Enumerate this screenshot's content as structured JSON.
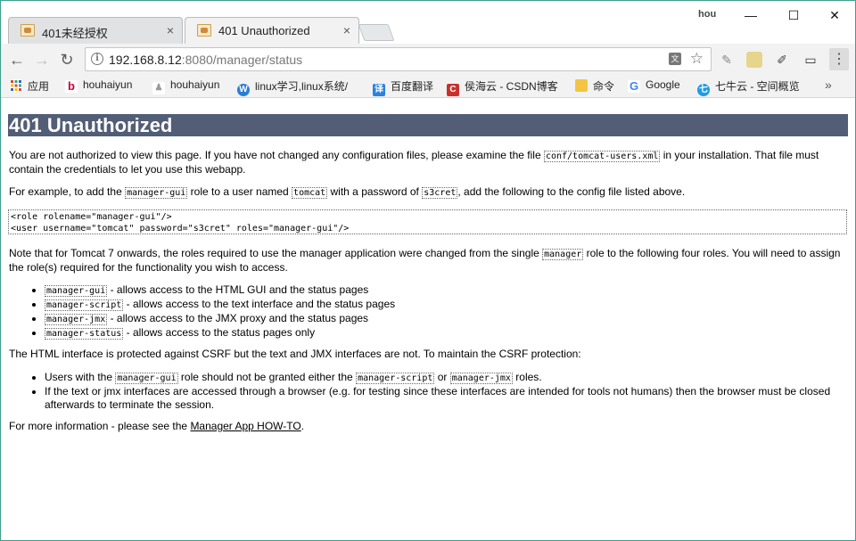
{
  "window": {
    "tabs": [
      {
        "label": "401未经授权",
        "close": "×",
        "active": false
      },
      {
        "label": "401 Unauthorized",
        "close": "×",
        "active": true
      }
    ],
    "user_badge": "hou",
    "minimize": "—",
    "maximize": "☐",
    "close": "✕"
  },
  "toolbar": {
    "back": "←",
    "forward": "→",
    "reload": "↻",
    "info_icon": "i",
    "url_host": "192.168.8.12",
    "url_rest": ":8080/manager/status",
    "star": "☆",
    "menu": "⋮"
  },
  "bookmarks": {
    "items": [
      {
        "label": "应用",
        "icon": "apps-icon"
      },
      {
        "label": "houhaiyun",
        "icon": "bookmark-icon"
      },
      {
        "label": "houhaiyun",
        "icon": "bookmark-icon"
      },
      {
        "label": "linux学习,linux系统/",
        "icon": "bookmark-icon"
      },
      {
        "label": "百度翻译",
        "icon": "translate-icon"
      },
      {
        "label": "侯海云 - CSDN博客",
        "icon": "csdn-icon"
      },
      {
        "label": "命令",
        "icon": "folder-icon"
      },
      {
        "label": "Google",
        "icon": "google-icon"
      },
      {
        "label": "七牛云 - 空间概览",
        "icon": "qiniu-icon"
      }
    ],
    "more": "»"
  },
  "page": {
    "title": "401 Unauthorized",
    "p1_a": "You are not authorized to view this page. If you have not changed any configuration files, please examine the file ",
    "p1_code": "conf/tomcat-users.xml",
    "p1_b": " in your installation. That file must",
    "p1_c": "contain the credentials to let you use this webapp.",
    "p2_a": "For example, to add the ",
    "p2_code1": "manager-gui",
    "p2_b": " role to a user named ",
    "p2_code2": "tomcat",
    "p2_c": " with a password of ",
    "p2_code3": "s3cret",
    "p2_d": ", add the following to the config file listed above.",
    "pre_line1": "<role rolename=\"manager-gui\"/>",
    "pre_line2": "<user username=\"tomcat\" password=\"s3cret\" roles=\"manager-gui\"/>",
    "p3_a": "Note that for Tomcat 7 onwards, the roles required to use the manager application were changed from the single ",
    "p3_code": "manager",
    "p3_b": " role to the following four roles. You will need to assign",
    "p3_c": "the role(s) required for the functionality you wish to access.",
    "roles": [
      {
        "code": "manager-gui",
        "text": " - allows access to the HTML GUI and the status pages"
      },
      {
        "code": "manager-script",
        "text": " - allows access to the text interface and the status pages"
      },
      {
        "code": "manager-jmx",
        "text": " - allows access to the JMX proxy and the status pages"
      },
      {
        "code": "manager-status",
        "text": " - allows access to the status pages only"
      }
    ],
    "p4": "The HTML interface is protected against CSRF but the text and JMX interfaces are not. To maintain the CSRF protection:",
    "csrf1_a": "Users with the ",
    "csrf1_code1": "manager-gui",
    "csrf1_b": " role should not be granted either the ",
    "csrf1_code2": "manager-script",
    "csrf1_c": " or ",
    "csrf1_code3": "manager-jmx",
    "csrf1_d": " roles.",
    "csrf2_a": "If the text or jmx interfaces are accessed through a browser (e.g. for testing since these interfaces are intended for tools not humans) then the browser must be closed",
    "csrf2_b": "afterwards to terminate the session.",
    "p5_a": "For more information - please see the ",
    "p5_link": "Manager App HOW-TO",
    "p5_b": "."
  }
}
